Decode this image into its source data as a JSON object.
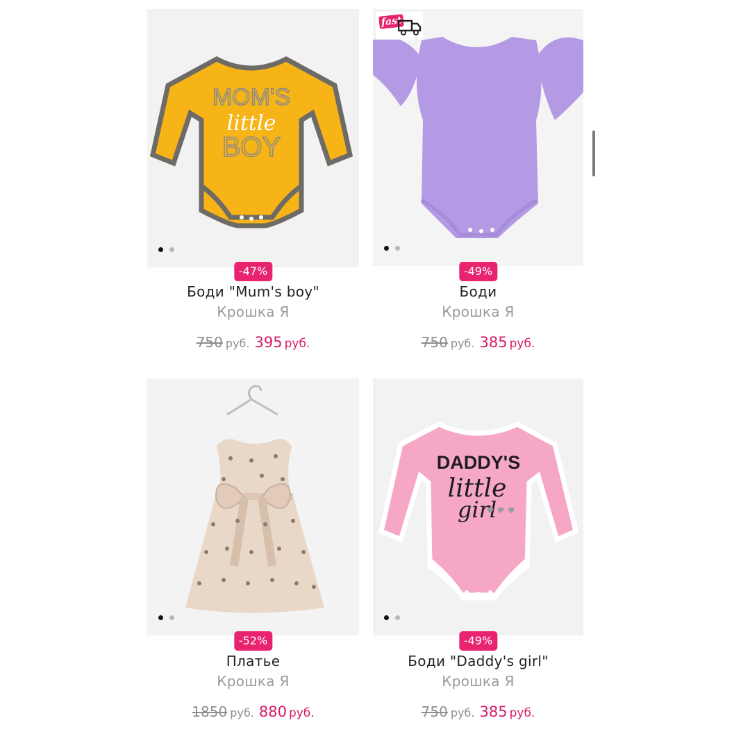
{
  "products": [
    {
      "name": "Боди \"Mum's boy\"",
      "brand": "Крошка Я",
      "discount": "-47%",
      "old_price": "750",
      "old_currency": "руб.",
      "new_price": "395",
      "new_currency": "руб.",
      "print": [
        "MOM'S",
        "little",
        "BOY"
      ],
      "colors": {
        "bg": "#f2f2f2",
        "body": "#f6b417",
        "trim": "#6e6a66",
        "print": "#8a8a8a"
      }
    },
    {
      "name": "Боди",
      "brand": "Крошка Я",
      "discount": "-49%",
      "old_price": "750",
      "old_currency": "руб.",
      "new_price": "385",
      "new_currency": "руб.",
      "fast_label": "fast",
      "colors": {
        "bg": "#f4f4f4",
        "body": "#b49ae4",
        "trim": "#a68bd9"
      }
    },
    {
      "name": "Платье",
      "brand": "Крошка Я",
      "discount": "-52%",
      "old_price": "1850",
      "old_currency": "руб.",
      "new_price": "880",
      "new_currency": "руб.",
      "colors": {
        "bg": "#f3f3f3",
        "body": "#e9d7c8",
        "pattern": "#8c7a6a"
      }
    },
    {
      "name": "Боди \"Daddy's girl\"",
      "brand": "Крошка Я",
      "discount": "-49%",
      "old_price": "750",
      "old_currency": "руб.",
      "new_price": "385",
      "new_currency": "руб.",
      "print": [
        "DADDY'S",
        "little",
        "girl"
      ],
      "colors": {
        "bg": "#f2f2f2",
        "body": "#f6a7c6",
        "trim": "#ffffff",
        "print": "#1d1d1d"
      }
    }
  ],
  "theme": {
    "accent": "#e8246e",
    "price_color": "#d81b67"
  }
}
